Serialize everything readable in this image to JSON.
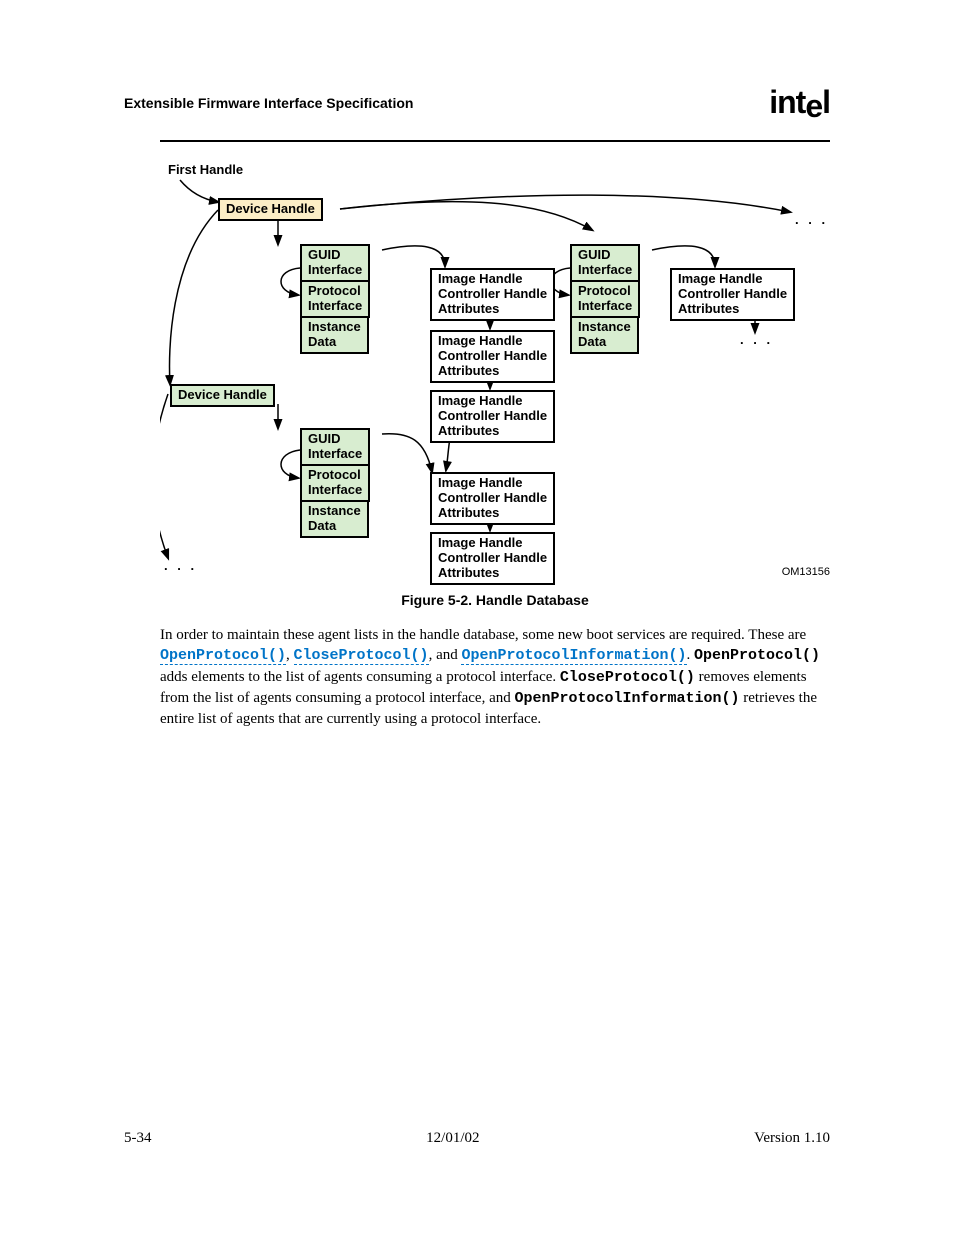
{
  "header": {
    "title": "Extensible Firmware Interface Specification",
    "logo": "intel"
  },
  "figure": {
    "om_label": "OM13156",
    "first_handle": "First Handle",
    "caption": "Figure 5-2.  Handle Database",
    "labels": {
      "device_handle": "Device Handle",
      "guid_interface_l1": "GUID",
      "guid_interface_l2": "Interface",
      "protocol_interface_l1": "Protocol",
      "protocol_interface_l2": "Interface",
      "instance_data_l1": "Instance",
      "instance_data_l2": "Data",
      "ihca_l1": "Image Handle",
      "ihca_l2": "Controller Handle",
      "ihca_l3": "Attributes"
    }
  },
  "body": {
    "p1_a": "In order to maintain these agent lists in the handle database, some new boot services are required. These are ",
    "link1": "OpenProtocol()",
    "sep1": ", ",
    "link2": "CloseProtocol()",
    "sep2": ", and ",
    "link3": "OpenProtocolInformation()",
    "p1_b": ". ",
    "mono1": "OpenProtocol()",
    "p2": " adds elements to the list of agents consuming a protocol interface. ",
    "mono2": "CloseProtocol()",
    "p3": " removes elements from the list of agents consuming a protocol interface, and ",
    "mono3": "OpenProtocolInformation()",
    "p4": " retrieves the entire list of agents that are currently using a protocol interface."
  },
  "footer": {
    "page": "5-34",
    "date": "12/01/02",
    "version": "Version 1.10"
  }
}
